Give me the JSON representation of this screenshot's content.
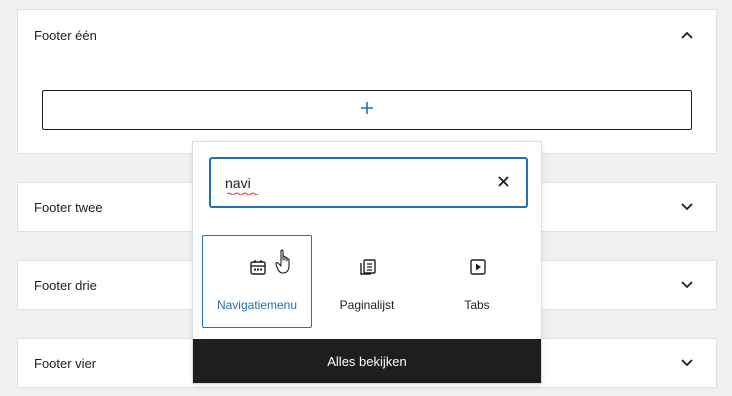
{
  "panels": [
    {
      "title": "Footer één",
      "expanded": true,
      "toggle_icon": "chevron-up-icon"
    },
    {
      "title": "Footer twee",
      "expanded": false,
      "toggle_icon": "chevron-down-icon"
    },
    {
      "title": "Footer drie",
      "expanded": false,
      "toggle_icon": "chevron-down-icon"
    },
    {
      "title": "Footer vier",
      "expanded": false,
      "toggle_icon": "chevron-down-icon"
    }
  ],
  "appender": {
    "icon": "plus-icon"
  },
  "inserter": {
    "search": {
      "value": "navi",
      "clear_icon": "close-icon"
    },
    "results": [
      {
        "label": "Navigatiemenu",
        "icon": "calendar-icon",
        "active": true
      },
      {
        "label": "Paginalijst",
        "icon": "page-list-icon",
        "active": false
      },
      {
        "label": "Tabs",
        "icon": "tabs-icon",
        "active": false
      }
    ],
    "browse_all": "Alles bekijken"
  },
  "colors": {
    "accent": "#2271b1",
    "background": "#f0f0f1",
    "dark": "#1e1e1e"
  }
}
